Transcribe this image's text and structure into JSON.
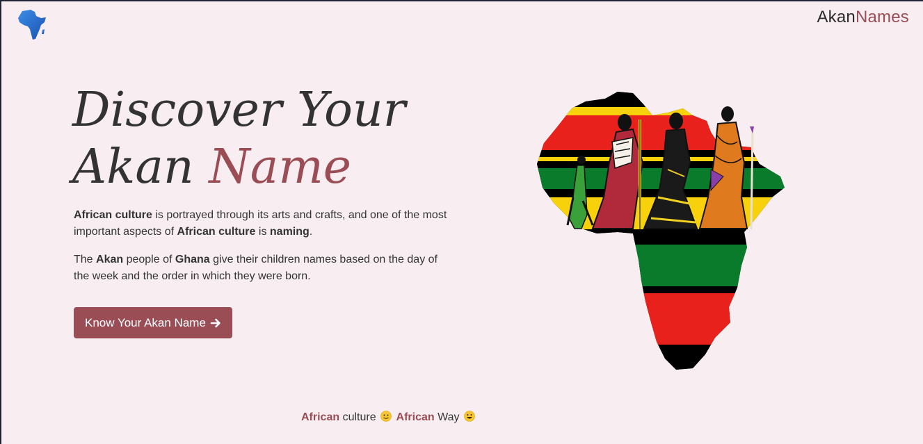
{
  "header": {
    "logo_icon": "africa-map-icon",
    "brand_part1": "Akan",
    "brand_part2": "Names"
  },
  "hero": {
    "title_line1": "Discover Your",
    "title_line2_plain": "Akan",
    "title_line2_accent": "Name",
    "para1": {
      "s1": "African culture",
      "s2": " is portrayed through its arts and crafts, and one of the most important aspects of ",
      "s3": "African culture",
      "s4": " is ",
      "s5": "naming",
      "s6": "."
    },
    "para2": {
      "s1": "The ",
      "s2": "Akan",
      "s3": " people of ",
      "s4": "Ghana",
      "s5": " give their children names based on the day of the week and the order in which they were born."
    },
    "cta_label": "Know Your Akan Name",
    "cta_icon": "arrow-right-icon"
  },
  "illustration": {
    "name": "africa-kente-figures-illustration",
    "stripe_colors": [
      "#f7d10c",
      "#e8211c",
      "#0a7a2b",
      "#000000"
    ]
  },
  "footer": {
    "w1": "African",
    "w2": "culture",
    "w3": "African",
    "w4": "Way",
    "emoji1": "slightly-smiling-face-emoji",
    "emoji2": "smiling-face-emoji"
  },
  "colors": {
    "accent": "#9b4d55",
    "background": "#f8eef1",
    "text": "#333333"
  }
}
